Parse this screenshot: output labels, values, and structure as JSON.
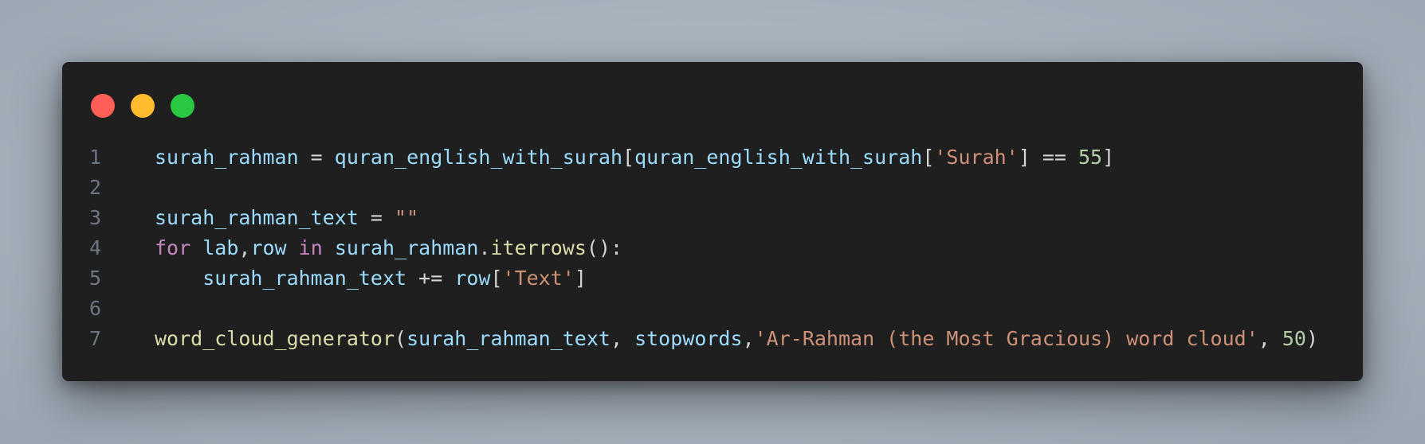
{
  "window": {
    "controls": {
      "close_color": "#ff5f57",
      "minimize_color": "#febc2e",
      "maximize_color": "#28c840"
    }
  },
  "code": {
    "language": "python",
    "lines": [
      {
        "number": "1",
        "tokens": [
          {
            "text": "surah_rahman",
            "type": "var"
          },
          {
            "text": " = ",
            "type": "op"
          },
          {
            "text": "quran_english_with_surah",
            "type": "var"
          },
          {
            "text": "[",
            "type": "punc"
          },
          {
            "text": "quran_english_with_surah",
            "type": "var"
          },
          {
            "text": "[",
            "type": "punc"
          },
          {
            "text": "'Surah'",
            "type": "str"
          },
          {
            "text": "] == ",
            "type": "op"
          },
          {
            "text": "55",
            "type": "num"
          },
          {
            "text": "]",
            "type": "punc"
          }
        ]
      },
      {
        "number": "2",
        "tokens": []
      },
      {
        "number": "3",
        "tokens": [
          {
            "text": "surah_rahman_text",
            "type": "var"
          },
          {
            "text": " = ",
            "type": "op"
          },
          {
            "text": "\"\"",
            "type": "str"
          }
        ]
      },
      {
        "number": "4",
        "tokens": [
          {
            "text": "for",
            "type": "kw"
          },
          {
            "text": " ",
            "type": "op"
          },
          {
            "text": "lab",
            "type": "var"
          },
          {
            "text": ",",
            "type": "punc"
          },
          {
            "text": "row",
            "type": "var"
          },
          {
            "text": " in ",
            "type": "kw"
          },
          {
            "text": "surah_rahman",
            "type": "var"
          },
          {
            "text": ".",
            "type": "punc"
          },
          {
            "text": "iterrows",
            "type": "fn"
          },
          {
            "text": "():",
            "type": "punc"
          }
        ]
      },
      {
        "number": "5",
        "tokens": [
          {
            "text": "    ",
            "type": "op"
          },
          {
            "text": "surah_rahman_text",
            "type": "var"
          },
          {
            "text": " += ",
            "type": "op"
          },
          {
            "text": "row",
            "type": "var"
          },
          {
            "text": "[",
            "type": "punc"
          },
          {
            "text": "'Text'",
            "type": "str"
          },
          {
            "text": "]",
            "type": "punc"
          }
        ]
      },
      {
        "number": "6",
        "tokens": []
      },
      {
        "number": "7",
        "tokens": [
          {
            "text": "word_cloud_generator",
            "type": "fn"
          },
          {
            "text": "(",
            "type": "punc"
          },
          {
            "text": "surah_rahman_text",
            "type": "var"
          },
          {
            "text": ", ",
            "type": "punc"
          },
          {
            "text": "stopwords",
            "type": "var"
          },
          {
            "text": ",",
            "type": "punc"
          },
          {
            "text": "'Ar-Rahman (the Most Gracious) word cloud'",
            "type": "str"
          },
          {
            "text": ", ",
            "type": "punc"
          },
          {
            "text": "50",
            "type": "num"
          },
          {
            "text": ")",
            "type": "punc"
          }
        ]
      }
    ]
  }
}
